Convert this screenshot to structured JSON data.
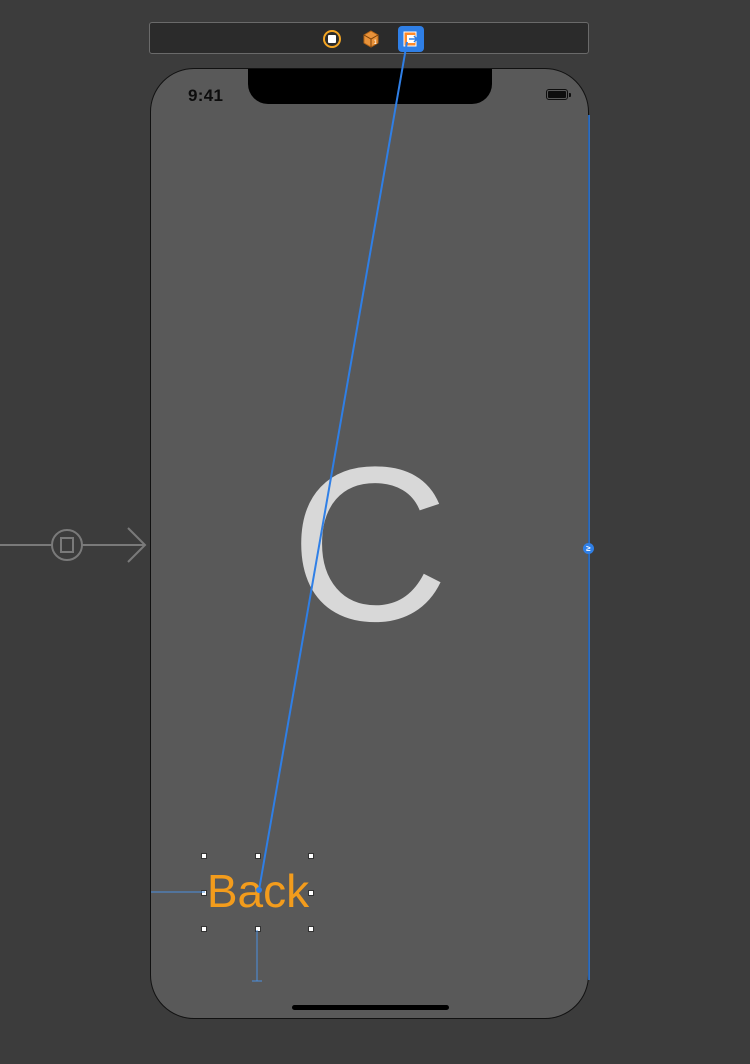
{
  "status_bar": {
    "time": "9:41"
  },
  "scene": {
    "title_letter": "C",
    "back_button_label": "Back"
  },
  "scene_dock": {
    "icons": [
      "view-controller-icon",
      "first-responder-icon",
      "exit-icon"
    ]
  },
  "colors": {
    "canvas": "#3c3c3c",
    "scene_background": "#595959",
    "title_letter": "#d8d8d8",
    "back_button": "#f39c1c",
    "connection_line": "#2f7fe6"
  }
}
